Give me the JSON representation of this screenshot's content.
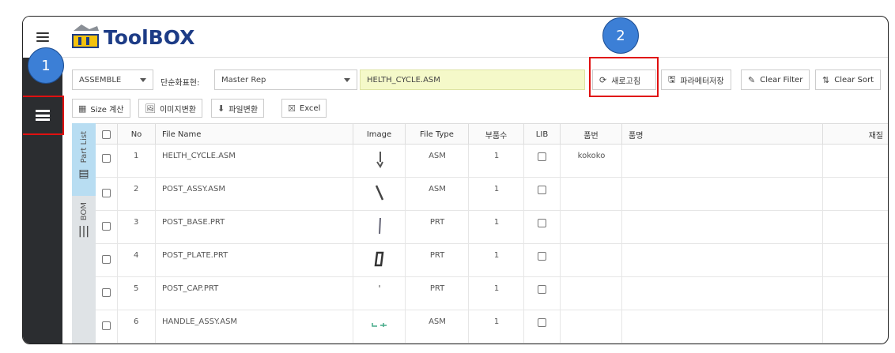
{
  "app": {
    "logo_text": "ToolBOX"
  },
  "toolbar": {
    "type_select": "ASSEMBLE",
    "simplified_rep_label": "단순화표현:",
    "rep_select": "Master Rep",
    "file_input": "HELTH_CYCLE.ASM",
    "refresh_label": "새로고침",
    "save_params_label": "파라메터저장",
    "clear_filter_label": "Clear Filter",
    "clear_sort_label": "Clear Sort"
  },
  "actions": {
    "size_calc": "Size 계산",
    "image_convert": "이미지변환",
    "file_convert": "파일변환",
    "excel": "Excel"
  },
  "tabs": {
    "part_list": "Part List",
    "bom": "BOM"
  },
  "table": {
    "headers": {
      "no": "No",
      "file_name": "File Name",
      "image": "Image",
      "file_type": "File Type",
      "qty": "부품수",
      "lib": "LIB",
      "part_no": "품번",
      "part_name": "품명",
      "material": "재질"
    },
    "rows": [
      {
        "no": "1",
        "file_name": "HELTH_CYCLE.ASM",
        "file_type": "ASM",
        "qty": "1",
        "part_no": "kokoko",
        "part_name": ""
      },
      {
        "no": "2",
        "file_name": "POST_ASSY.ASM",
        "file_type": "ASM",
        "qty": "1",
        "part_no": "",
        "part_name": ""
      },
      {
        "no": "3",
        "file_name": "POST_BASE.PRT",
        "file_type": "PRT",
        "qty": "1",
        "part_no": "",
        "part_name": ""
      },
      {
        "no": "4",
        "file_name": "POST_PLATE.PRT",
        "file_type": "PRT",
        "qty": "1",
        "part_no": "",
        "part_name": ""
      },
      {
        "no": "5",
        "file_name": "POST_CAP.PRT",
        "file_type": "PRT",
        "qty": "1",
        "part_no": "",
        "part_name": ""
      },
      {
        "no": "6",
        "file_name": "HANDLE_ASSY.ASM",
        "file_type": "ASM",
        "qty": "1",
        "part_no": "",
        "part_name": ""
      }
    ]
  },
  "annotations": {
    "marker_1": "1",
    "marker_2": "2"
  }
}
